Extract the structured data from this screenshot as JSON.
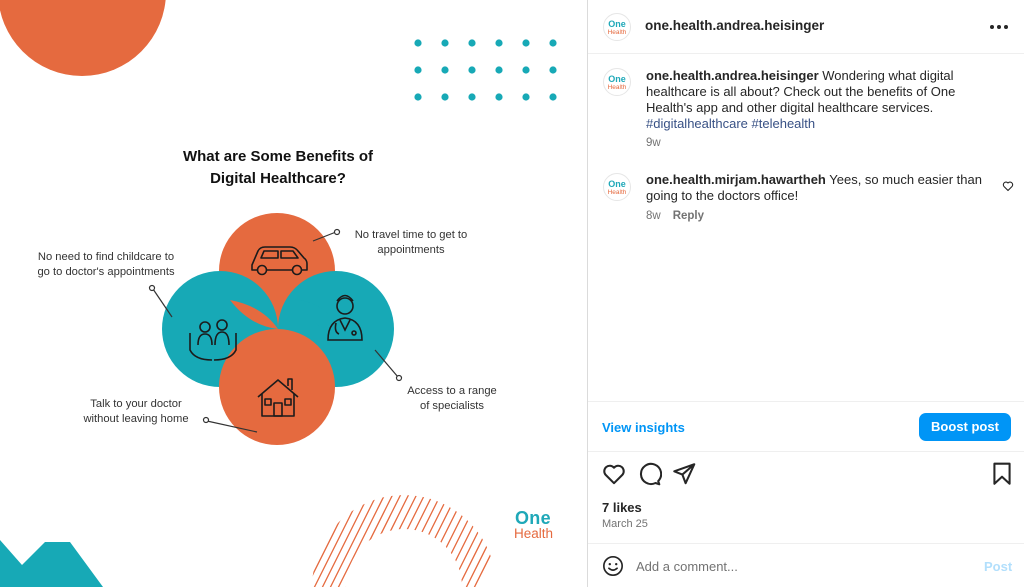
{
  "image": {
    "title_line1": "What are Some Benefits of",
    "title_line2": "Digital Healthcare?",
    "benefits": {
      "childcare_line1": "No need to find childcare to",
      "childcare_line2": "go to doctor's appointments",
      "travel_line1": "No travel time to get to",
      "travel_line2": "appointments",
      "specialists_line1": "Access to a range",
      "specialists_line2": "of specialists",
      "home_line1": "Talk to your doctor",
      "home_line2": "without leaving home"
    },
    "logo_line1": "One",
    "logo_line2": "Health",
    "colors": {
      "orange": "#e56a3f",
      "teal": "#17a9b6"
    }
  },
  "header": {
    "username": "one.health.andrea.heisinger",
    "avatar_line1": "One",
    "avatar_line2": "Health"
  },
  "caption": {
    "username": "one.health.andrea.heisinger",
    "text": " Wondering what digital healthcare is all about? Check out the benefits of One Health's app and other digital healthcare services. ",
    "hashtag1": "#digitalhealthcare",
    "hashtag2": "#telehealth",
    "time": "9w"
  },
  "comment": {
    "username": "one.health.mirjam.hawartheh",
    "text": " Yees, so much easier than going to the doctors office!",
    "time": "8w",
    "reply_label": "Reply"
  },
  "insights": {
    "view_label": "View insights",
    "boost_label": "Boost post"
  },
  "stats": {
    "likes": "7 likes",
    "date": "March 25"
  },
  "add_comment": {
    "placeholder": "Add a comment...",
    "post_label": "Post"
  },
  "icons": [
    "more-icon",
    "heart-icon",
    "comment-icon",
    "share-icon",
    "bookmark-icon",
    "emoji-icon",
    "car-icon",
    "doctor-icon",
    "house-icon",
    "family-icon"
  ]
}
